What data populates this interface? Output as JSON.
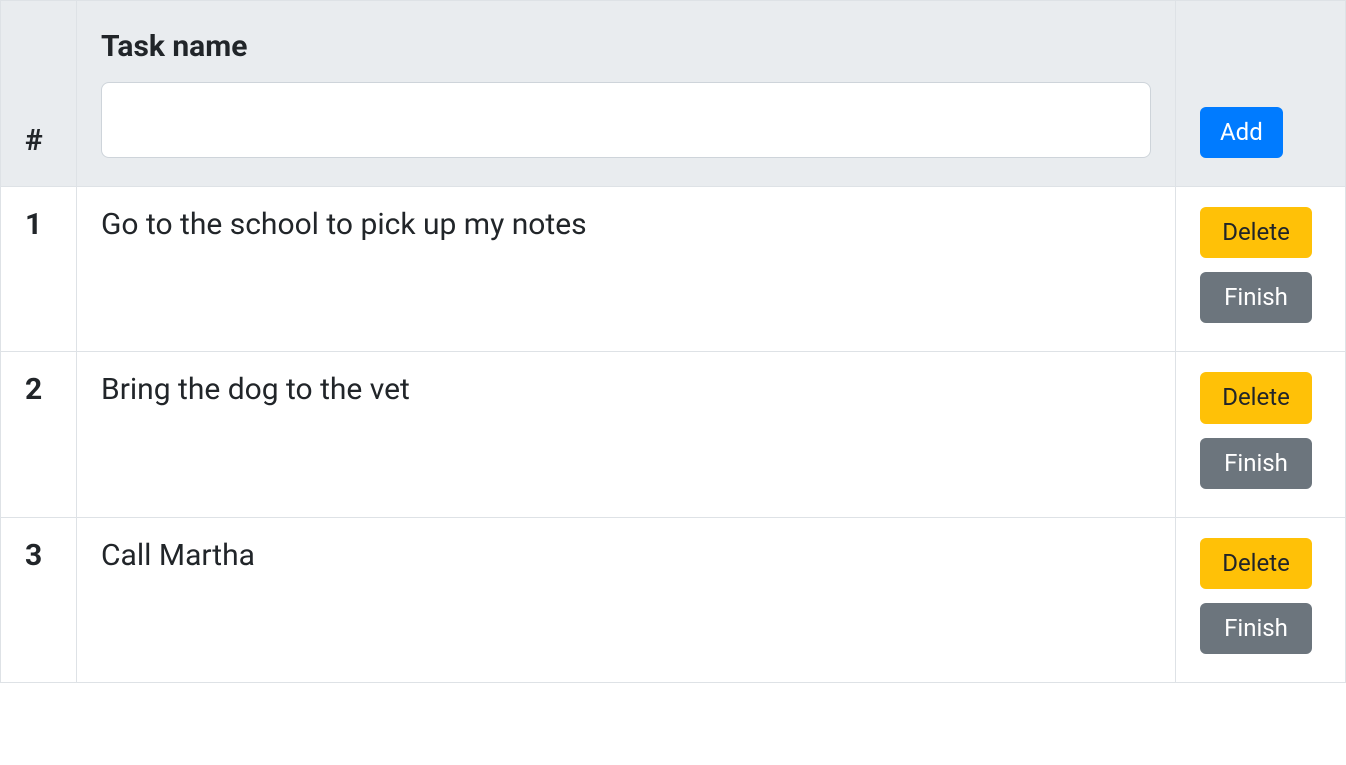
{
  "header": {
    "index_label": "#",
    "name_label": "Task name",
    "add_button_label": "Add",
    "input_value": "",
    "input_placeholder": ""
  },
  "actions": {
    "delete_label": "Delete",
    "finish_label": "Finish"
  },
  "tasks": [
    {
      "index": "1",
      "name": "Go to the school to pick up my notes"
    },
    {
      "index": "2",
      "name": "Bring the dog to the vet"
    },
    {
      "index": "3",
      "name": "Call Martha"
    }
  ],
  "colors": {
    "primary": "#007bff",
    "warning": "#ffc107",
    "secondary": "#6c757d",
    "header_bg": "#e9ecef",
    "border": "#dee2e6"
  }
}
